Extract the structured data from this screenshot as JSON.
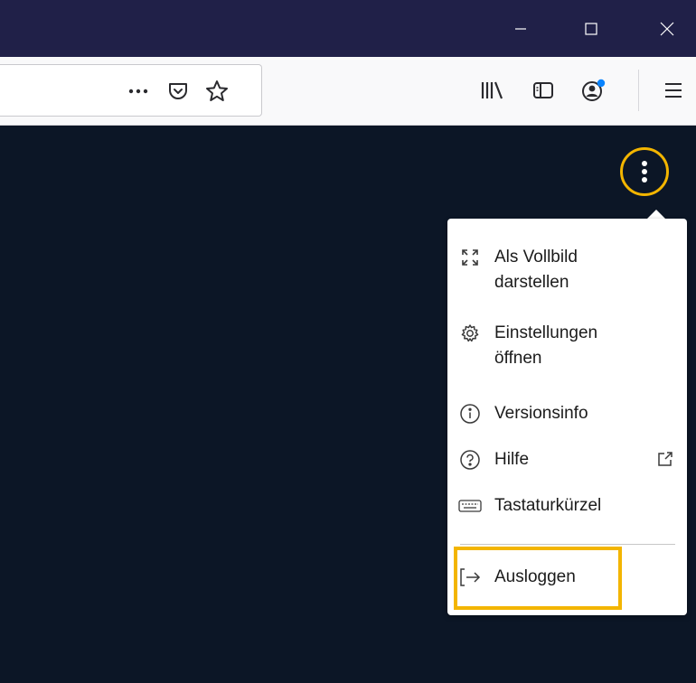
{
  "titlebar": {
    "minimize_icon": "minimize-icon",
    "maximize_icon": "maximize-icon",
    "close_icon": "close-icon"
  },
  "toolbar": {
    "page_actions_icon": "more-horizontal-icon",
    "pocket_icon": "pocket-icon",
    "bookmark_icon": "star-icon",
    "library_icon": "library-icon",
    "sidebar_icon": "sidebar-icon",
    "account_icon": "account-icon",
    "account_badge_color": "#0a84ff",
    "menu_icon": "hamburger-menu-icon"
  },
  "app": {
    "background_color": "#0c1626",
    "kebab_icon": "vertical-dots-icon",
    "highlight_color": "#f3b500"
  },
  "menu": {
    "items": [
      {
        "label": "Als Vollbild\ndarstellen",
        "icon": "fullscreen-icon"
      },
      {
        "label": "Einstellungen\nöffnen",
        "icon": "gear-icon"
      },
      {
        "label": "Versionsinfo",
        "icon": "info-icon"
      },
      {
        "label": "Hilfe",
        "icon": "help-icon",
        "trailing_icon": "external-link-icon"
      },
      {
        "label": "Tastaturkürzel",
        "icon": "keyboard-icon"
      },
      {
        "label": "Ausloggen",
        "icon": "logout-icon"
      }
    ]
  }
}
